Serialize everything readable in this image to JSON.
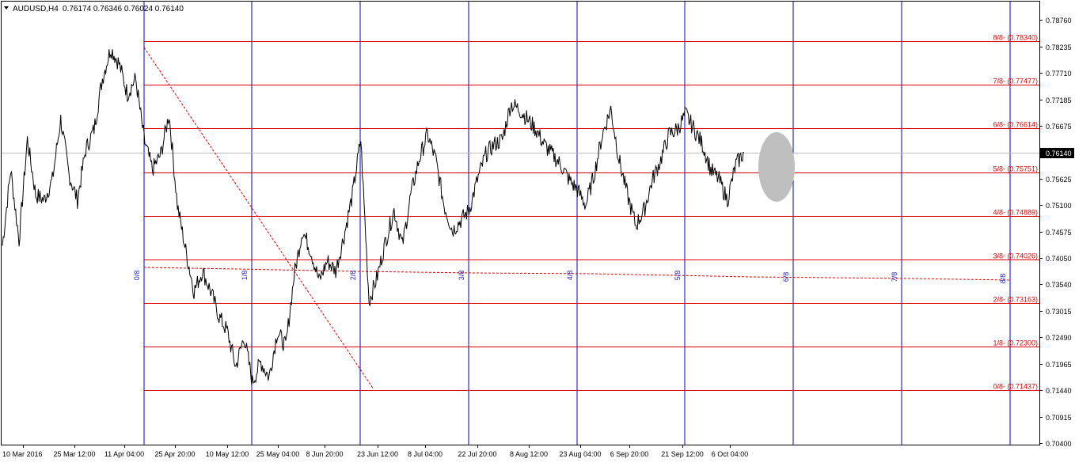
{
  "header": {
    "symbol_timeframe": "AUDUSD,H4",
    "ohlc": "0.76174 0.76346 0.76024 0.76140"
  },
  "current_price_label": "0.76140",
  "colors": {
    "background": "#ffffff",
    "price_line": "#000000",
    "murrey_lines": "#e00000",
    "time_grid": "#0000c0",
    "time_labels": "#2020c0",
    "diagonal": "#e00000",
    "ellipse": "#bfbfbf",
    "current_price_line": "#c0c0c0"
  },
  "chart_data": {
    "type": "line",
    "title": "",
    "instrument": "AUDUSD",
    "timeframe": "H4",
    "ylim": [
      0.70365,
      0.7914
    ],
    "y_ticks": [
      "0.78760",
      "0.78235",
      "0.77710",
      "0.77185",
      "0.76675",
      "0.76140",
      "0.75625",
      "0.75100",
      "0.74575",
      "0.74050",
      "0.73540",
      "0.73015",
      "0.72490",
      "0.71965",
      "0.71440",
      "0.70915",
      "0.70400"
    ],
    "x_tick_labels": [
      "10 Mar 2016",
      "25 Mar 12:00",
      "11 Apr 04:00",
      "25 Apr 20:00",
      "10 May 12:00",
      "25 May 04:00",
      "8 Jun 20:00",
      "23 Jun 12:00",
      "8 Jul 04:00",
      "22 Jul 20:00",
      "8 Aug 12:00",
      "23 Aug 04:00",
      "6 Sep 20:00",
      "21 Sep 12:00",
      "6 Oct 04:00"
    ],
    "current_price": 0.7614,
    "murrey_levels": [
      {
        "label": "8/8- (0.78340)",
        "value": 0.7834
      },
      {
        "label": "7/8- (0.77477)",
        "value": 0.77477
      },
      {
        "label": "6/8- (0.76614)",
        "value": 0.76614
      },
      {
        "label": "5/8- (0.75751)",
        "value": 0.75751
      },
      {
        "label": "4/8- (0.74889)",
        "value": 0.74889
      },
      {
        "label": "3/8- (0.74026)",
        "value": 0.74026
      },
      {
        "label": "2/8- (0.73163)",
        "value": 0.73163
      },
      {
        "label": "1/8- (0.72300)",
        "value": 0.723
      },
      {
        "label": "0/8- (0.71437)",
        "value": 0.71437
      }
    ],
    "time_divisions": [
      "0/8",
      "1/8",
      "2/8",
      "3/8",
      "4/8",
      "5/8",
      "6/8",
      "7/8",
      "8/8"
    ],
    "price_series": [
      {
        "x": "10 Mar 2016",
        "y": 0.743
      },
      {
        "x": "13 Mar 2016",
        "y": 0.758
      },
      {
        "x": "16 Mar 2016",
        "y": 0.744
      },
      {
        "x": "19 Mar 2016",
        "y": 0.764
      },
      {
        "x": "22 Mar 2016",
        "y": 0.753
      },
      {
        "x": "25 Mar 12:00",
        "y": 0.752
      },
      {
        "x": "28 Mar 2016",
        "y": 0.756
      },
      {
        "x": "31 Mar 2016",
        "y": 0.768
      },
      {
        "x": "3 Apr 2016",
        "y": 0.757
      },
      {
        "x": "6 Apr 2016",
        "y": 0.752
      },
      {
        "x": "9 Apr 2016",
        "y": 0.762
      },
      {
        "x": "11 Apr 04:00",
        "y": 0.766
      },
      {
        "x": "13 Apr 2016",
        "y": 0.776
      },
      {
        "x": "15 Apr 2016",
        "y": 0.782
      },
      {
        "x": "17 Apr 2016",
        "y": 0.779
      },
      {
        "x": "19 Apr 2016",
        "y": 0.773
      },
      {
        "x": "21 Apr 2016",
        "y": 0.776
      },
      {
        "x": "23 Apr 2016",
        "y": 0.764
      },
      {
        "x": "25 Apr 20:00",
        "y": 0.758
      },
      {
        "x": "27 Apr 2016",
        "y": 0.761
      },
      {
        "x": "29 Apr 2016",
        "y": 0.769
      },
      {
        "x": "2 May 2016",
        "y": 0.751
      },
      {
        "x": "4 May 2016",
        "y": 0.742
      },
      {
        "x": "6 May 2016",
        "y": 0.734
      },
      {
        "x": "8 May 2016",
        "y": 0.738
      },
      {
        "x": "10 May 12:00",
        "y": 0.734
      },
      {
        "x": "12 May 2016",
        "y": 0.729
      },
      {
        "x": "14 May 2016",
        "y": 0.726
      },
      {
        "x": "17 May 2016",
        "y": 0.719
      },
      {
        "x": "19 May 2016",
        "y": 0.725
      },
      {
        "x": "21 May 2016",
        "y": 0.716
      },
      {
        "x": "23 May 2016",
        "y": 0.72
      },
      {
        "x": "25 May 04:00",
        "y": 0.717
      },
      {
        "x": "28 May 2016",
        "y": 0.726
      },
      {
        "x": "31 May 2016",
        "y": 0.723
      },
      {
        "x": "3 Jun 2016",
        "y": 0.737
      },
      {
        "x": "6 Jun 2016",
        "y": 0.746
      },
      {
        "x": "8 Jun 20:00",
        "y": 0.742
      },
      {
        "x": "11 Jun 2016",
        "y": 0.736
      },
      {
        "x": "14 Jun 2016",
        "y": 0.74
      },
      {
        "x": "17 Jun 2016",
        "y": 0.738
      },
      {
        "x": "20 Jun 2016",
        "y": 0.745
      },
      {
        "x": "22 Jun 2016",
        "y": 0.753
      },
      {
        "x": "23 Jun 12:00",
        "y": 0.764
      },
      {
        "x": "24 Jun 2016",
        "y": 0.732
      },
      {
        "x": "27 Jun 2016",
        "y": 0.737
      },
      {
        "x": "30 Jun 2016",
        "y": 0.744
      },
      {
        "x": "3 Jul 2016",
        "y": 0.75
      },
      {
        "x": "6 Jul 2016",
        "y": 0.743
      },
      {
        "x": "8 Jul 04:00",
        "y": 0.753
      },
      {
        "x": "10 Jul 2016",
        "y": 0.76
      },
      {
        "x": "13 Jul 2016",
        "y": 0.765
      },
      {
        "x": "16 Jul 2016",
        "y": 0.76
      },
      {
        "x": "18 Jul 2016",
        "y": 0.751
      },
      {
        "x": "20 Jul 2016",
        "y": 0.746
      },
      {
        "x": "22 Jul 20:00",
        "y": 0.748
      },
      {
        "x": "24 Jul 2016",
        "y": 0.75
      },
      {
        "x": "26 Jul 2016",
        "y": 0.756
      },
      {
        "x": "29 Jul 2016",
        "y": 0.761
      },
      {
        "x": "1 Aug 2016",
        "y": 0.763
      },
      {
        "x": "4 Aug 2016",
        "y": 0.764
      },
      {
        "x": "6 Aug 2016",
        "y": 0.771
      },
      {
        "x": "8 Aug 12:00",
        "y": 0.77
      },
      {
        "x": "11 Aug 2016",
        "y": 0.768
      },
      {
        "x": "14 Aug 2016",
        "y": 0.766
      },
      {
        "x": "17 Aug 2016",
        "y": 0.763
      },
      {
        "x": "20 Aug 2016",
        "y": 0.761
      },
      {
        "x": "23 Aug 04:00",
        "y": 0.759
      },
      {
        "x": "24 Aug 2016",
        "y": 0.756
      },
      {
        "x": "26 Aug 2016",
        "y": 0.754
      },
      {
        "x": "29 Aug 2016",
        "y": 0.751
      },
      {
        "x": "1 Sep 2016",
        "y": 0.757
      },
      {
        "x": "4 Sep 2016",
        "y": 0.765
      },
      {
        "x": "6 Sep 20:00",
        "y": 0.77
      },
      {
        "x": "8 Sep 2016",
        "y": 0.76
      },
      {
        "x": "10 Sep 2016",
        "y": 0.753
      },
      {
        "x": "12 Sep 2016",
        "y": 0.747
      },
      {
        "x": "14 Sep 2016",
        "y": 0.75
      },
      {
        "x": "17 Sep 2016",
        "y": 0.756
      },
      {
        "x": "19 Sep 2016",
        "y": 0.76
      },
      {
        "x": "21 Sep 12:00",
        "y": 0.765
      },
      {
        "x": "24 Sep 2016",
        "y": 0.766
      },
      {
        "x": "27 Sep 2016",
        "y": 0.769
      },
      {
        "x": "30 Sep 2016",
        "y": 0.766
      },
      {
        "x": "3 Oct 2016",
        "y": 0.763
      },
      {
        "x": "6 Oct 04:00",
        "y": 0.758
      },
      {
        "x": "8 Oct 2016",
        "y": 0.756
      },
      {
        "x": "10 Oct 2016",
        "y": 0.752
      },
      {
        "x": "11 Oct 2016",
        "y": 0.759
      },
      {
        "x": "12 Oct 2016",
        "y": 0.7614
      }
    ]
  }
}
